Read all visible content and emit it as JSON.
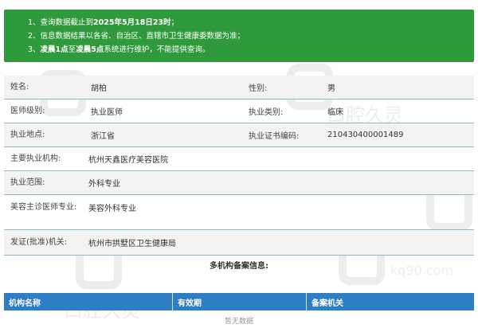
{
  "notice": {
    "line1_pre": "1、查询数据截止到",
    "line1_bold": "2025年5月18日23时",
    "line1_post": "；",
    "line2": "2、信息数据结果以各省、自治区、直辖市卫生健康委数据为准；",
    "line3_pre": "3、",
    "line3_bold1": "凌晨1点",
    "line3_mid": "至",
    "line3_bold2": "凌晨5点",
    "line3_post": "系统进行维护，不能提供查询。"
  },
  "info": {
    "name_label": "姓名:",
    "name_value": "胡柏",
    "gender_label": "性别:",
    "gender_value": "男",
    "level_label": "医师级别:",
    "level_value": "执业医师",
    "category_label": "执业类别:",
    "category_value": "临床",
    "place_label": "执业地点:",
    "place_value": "浙江省",
    "cert_label": "执业证书编码:",
    "cert_value": "210430400001489",
    "org_label": "主要执业机构:",
    "org_value": "杭州天鑫医疗美容医院",
    "scope_label": "执业范围:",
    "scope_value": "外科专业",
    "beauty_label": "美容主诊医师专业:",
    "beauty_value": "美容外科专业",
    "issuer_label": "发证(批准)机关:",
    "issuer_value": "杭州市拱墅区卫生健康局"
  },
  "multi": {
    "title": "多机构备案信息:",
    "columns": [
      "机构名称",
      "有效期",
      "备案机关"
    ],
    "empty": "暂无数据"
  },
  "watermark": {
    "text": "口腔久灵",
    "url": "kq90.com"
  }
}
